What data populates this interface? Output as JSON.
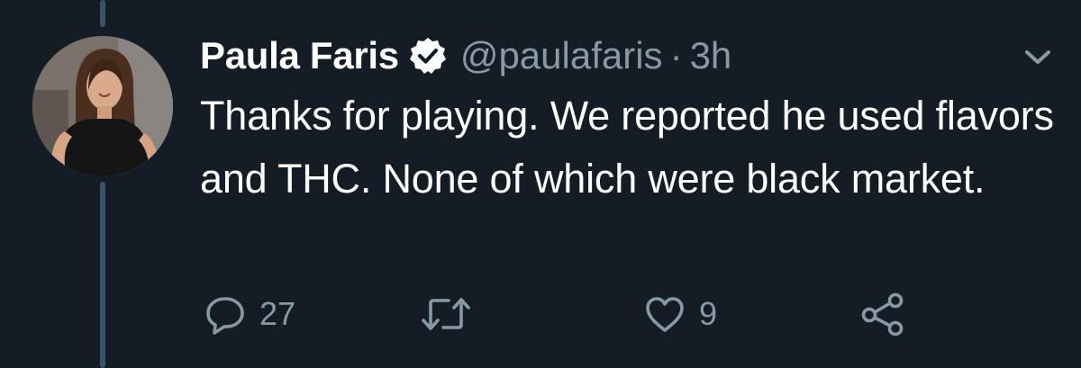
{
  "tweet": {
    "author": {
      "display_name": "Paula Faris",
      "handle": "@paulafaris",
      "verified": true,
      "avatar_icon": "profile-photo"
    },
    "separator": "·",
    "timestamp": "3h",
    "text": "Thanks for playing. We reported he used flavors and THC. None of which were black market.",
    "actions": {
      "reply": {
        "icon": "reply-icon",
        "count": "27"
      },
      "retweet": {
        "icon": "retweet-icon",
        "count": ""
      },
      "like": {
        "icon": "heart-icon",
        "count": "9"
      },
      "share": {
        "icon": "share-icon",
        "count": ""
      }
    }
  },
  "colors": {
    "background": "#141d26",
    "text_primary": "#ffffff",
    "text_secondary": "#8899a6",
    "thread_line": "#3d5466"
  }
}
